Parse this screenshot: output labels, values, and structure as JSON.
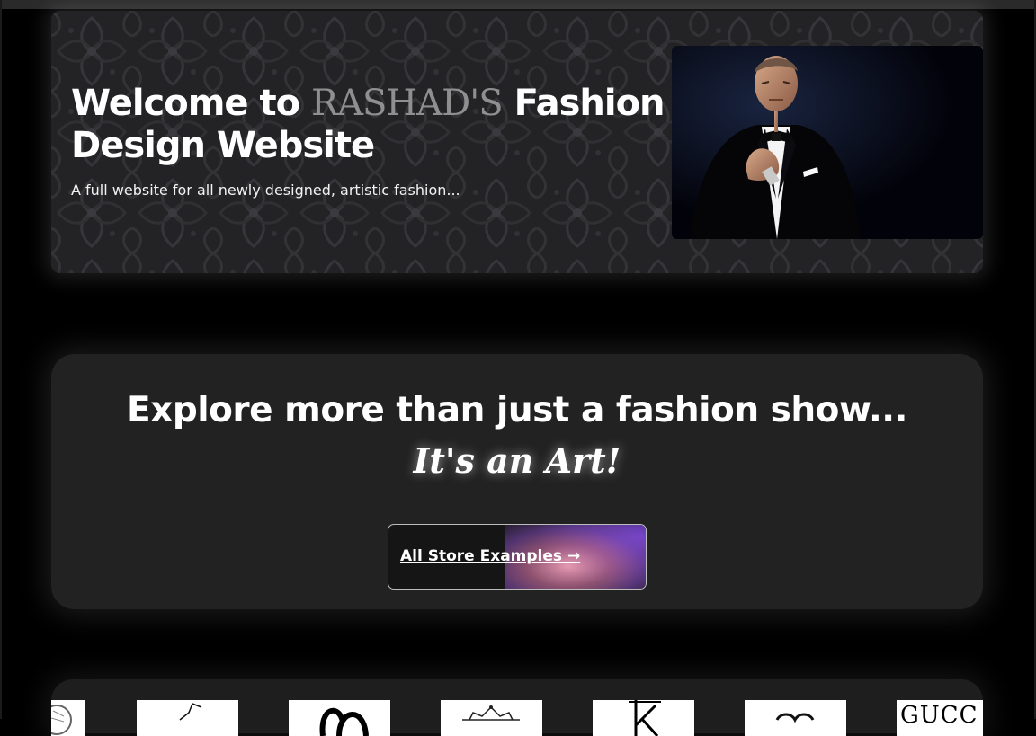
{
  "hero": {
    "title_prefix": "Welcome to",
    "brand": "RASHAD'S",
    "title_suffix": "Fashion Design Website",
    "subtitle": "A full website for all newly designed, artistic fashion..."
  },
  "explore": {
    "title": "Explore more than just a fashion show...",
    "tagline": "It's an Art!",
    "button_label": "All Store Examples →"
  },
  "logos": {
    "items": [
      "versace-logo",
      "chanel-logo",
      "dior-logo",
      "crown-brand-logo",
      "k-brand-logo",
      "brand-logo",
      "gucci-logo"
    ],
    "gucci_text": "GUCC"
  },
  "colors": {
    "page_bg": "#000000",
    "card_bg": "#222222",
    "brand_text": "#8f8f8f",
    "button_border": "#bdbdbd"
  }
}
